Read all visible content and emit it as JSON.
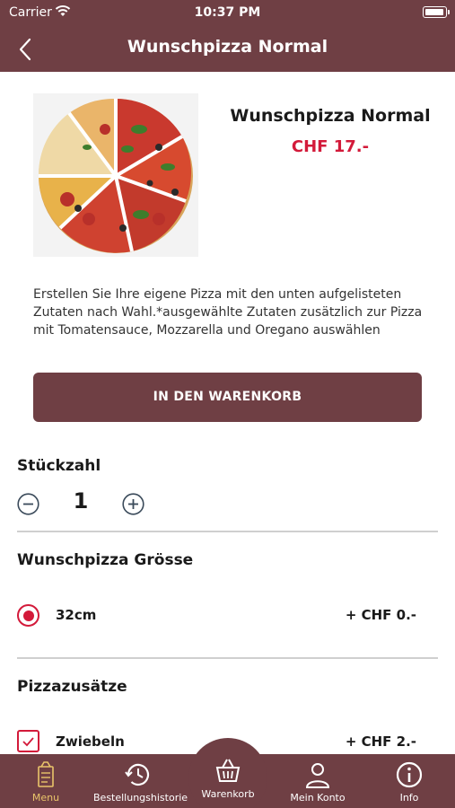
{
  "status_bar": {
    "carrier": "Carrier",
    "time": "10:37 PM"
  },
  "nav": {
    "title": "Wunschpizza Normal",
    "back_icon": "chevron-left-icon"
  },
  "product": {
    "name": "Wunschpizza Normal",
    "price": "CHF 17.-",
    "description": "Erstellen Sie Ihre eigene Pizza mit den unten aufgelisteten Zutaten nach Wahl.*ausgewählte Zutaten zusätzlich zur Pizza mit Tomatensauce, Mozzarella und Oregano auswählen",
    "image": "pizza-slices-image"
  },
  "cart_button": {
    "label": "IN DEN WARENKORB"
  },
  "quantity": {
    "title": "Stückzahl",
    "value": "1"
  },
  "size_section": {
    "title": "Wunschpizza Grösse",
    "options": [
      {
        "label": "32cm",
        "price": "+ CHF 0.-",
        "selected": true
      }
    ]
  },
  "extras_section": {
    "title": "Pizzazusätze",
    "options": [
      {
        "label": "Zwiebeln",
        "price": "+ CHF 2.-",
        "checked": false
      }
    ]
  },
  "tabbar": {
    "items": [
      {
        "label": "Menu",
        "icon": "menu-icon",
        "active": true
      },
      {
        "label": "Bestellungshistorie",
        "icon": "history-icon"
      },
      {
        "label": "Warenkorb",
        "icon": "basket-icon"
      },
      {
        "label": "Mein Konto",
        "icon": "person-icon"
      },
      {
        "label": "Info",
        "icon": "info-icon"
      }
    ]
  },
  "colors": {
    "primary": "#6f3f44",
    "accent": "#d31a3a",
    "active_tab": "#e9c46a"
  }
}
